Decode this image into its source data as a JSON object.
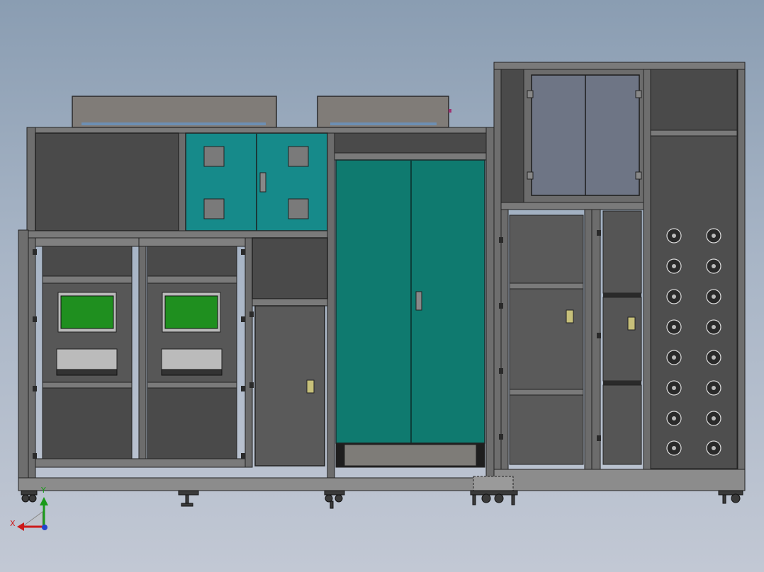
{
  "colors": {
    "frame": "#7c7c7c",
    "frame_dark": "#2e2e2e",
    "panel_dark": "#4a4a4a",
    "panel_mid": "#5a5a5a",
    "teal_door": "#0f7a6f",
    "teal_cabinet": "#168a8a",
    "glass": "#6e7585",
    "screen": "#1f8f1f",
    "lid": "#807c78"
  },
  "axis": {
    "x_label": "X",
    "y_label": "Y"
  },
  "icons": {
    "fan": "fan-icon",
    "handle": "door-handle-icon",
    "hinge": "hinge-icon",
    "wheel": "caster-wheel-icon",
    "triad": "axis-triad-icon"
  }
}
